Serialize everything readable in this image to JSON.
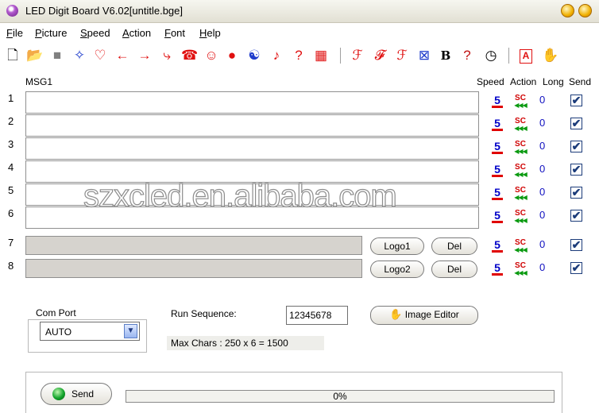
{
  "window": {
    "title": "LED Digit Board V6.02[untitle.bge]"
  },
  "menu": [
    {
      "label": "File",
      "u": "F",
      "rest": "ile"
    },
    {
      "label": "Picture",
      "u": "P",
      "rest": "icture"
    },
    {
      "label": "Speed",
      "u": "S",
      "rest": "peed"
    },
    {
      "label": "Action",
      "u": "A",
      "rest": "ction"
    },
    {
      "label": "Font",
      "u": "F",
      "rest": "ont"
    },
    {
      "label": "Help",
      "u": "H",
      "rest": "elp"
    }
  ],
  "toolbar": [
    {
      "icon": "new-file-icon",
      "glyph": "🗋",
      "color": "#000000"
    },
    {
      "icon": "open-folder-icon",
      "glyph": "📂",
      "color": "#c08a00"
    },
    {
      "icon": "gray-square-icon",
      "glyph": "■",
      "color": "#808080"
    },
    {
      "icon": "sparkle-icon",
      "glyph": "✧",
      "color": "#1e3ccc"
    },
    {
      "icon": "heart-icon",
      "glyph": "♡",
      "color": "#e01010"
    },
    {
      "icon": "arrow-left-icon",
      "glyph": "←",
      "color": "#e01010"
    },
    {
      "icon": "arrow-right-icon",
      "glyph": "→",
      "color": "#e01010"
    },
    {
      "icon": "step-arrow-icon",
      "glyph": "⤷",
      "color": "#e01010"
    },
    {
      "icon": "phone-icon",
      "glyph": "☎",
      "color": "#e01010"
    },
    {
      "icon": "smiley-icon",
      "glyph": "☺",
      "color": "#e01010"
    },
    {
      "icon": "red-dot-icon",
      "glyph": "●",
      "color": "#e01010"
    },
    {
      "icon": "yin-yang-icon",
      "glyph": "☯",
      "color": "#1e3ccc"
    },
    {
      "icon": "music-note-icon",
      "glyph": "♪",
      "color": "#e01010"
    },
    {
      "icon": "question-icon",
      "glyph": "?",
      "color": "#e01010"
    },
    {
      "icon": "red-box-icon",
      "glyph": "▦",
      "color": "#e01010"
    },
    {
      "icon": "font-f1-icon",
      "glyph": "ℱ",
      "color": "#e01010"
    },
    {
      "icon": "font-f2-icon",
      "glyph": "𝓕",
      "color": "#e01010"
    },
    {
      "icon": "font-f3-icon",
      "glyph": "ℱ",
      "color": "#e01010"
    },
    {
      "icon": "pattern-icon",
      "glyph": "⊠",
      "color": "#1e3ccc"
    },
    {
      "icon": "bold-icon",
      "glyph": "B",
      "color": "#000000"
    },
    {
      "icon": "user-help-icon",
      "glyph": "?",
      "color": "#c01010"
    },
    {
      "icon": "clock-icon",
      "glyph": "◷",
      "color": "#000000"
    },
    {
      "icon": "font-a-icon",
      "glyph": "A",
      "color": "#e01010"
    },
    {
      "icon": "settings-icon",
      "glyph": "✋",
      "color": "#705000"
    }
  ],
  "grid": {
    "msg_label": "MSG1",
    "headers": {
      "speed": "Speed",
      "action": "Action",
      "long": "Long",
      "send": "Send"
    },
    "rows": [
      {
        "num": "1",
        "speed": "5",
        "action": "SC",
        "long": "0",
        "send": true
      },
      {
        "num": "2",
        "speed": "5",
        "action": "SC",
        "long": "0",
        "send": true
      },
      {
        "num": "3",
        "speed": "5",
        "action": "SC",
        "long": "0",
        "send": true
      },
      {
        "num": "4",
        "speed": "5",
        "action": "SC",
        "long": "0",
        "send": true
      },
      {
        "num": "5",
        "speed": "5",
        "action": "SC",
        "long": "0",
        "send": true
      },
      {
        "num": "6",
        "speed": "5",
        "action": "SC",
        "long": "0",
        "send": true
      },
      {
        "num": "7",
        "speed": "5",
        "action": "SC",
        "long": "0",
        "send": true,
        "logo": "Logo1",
        "del": "Del"
      },
      {
        "num": "8",
        "speed": "5",
        "action": "SC",
        "long": "0",
        "send": true,
        "logo": "Logo2",
        "del": "Del"
      }
    ]
  },
  "com_port": {
    "label": "Com Port",
    "value": "AUTO"
  },
  "run_sequence": {
    "label": "Run Sequence:",
    "value": "12345678"
  },
  "max_chars": "Max Chars : 250 x 6 = 1500",
  "image_editor": {
    "label": "Image Editor"
  },
  "send": {
    "label": "Send"
  },
  "progress": {
    "label": "0%",
    "value": 0
  },
  "watermark": "szxcled.en.alibaba.com"
}
